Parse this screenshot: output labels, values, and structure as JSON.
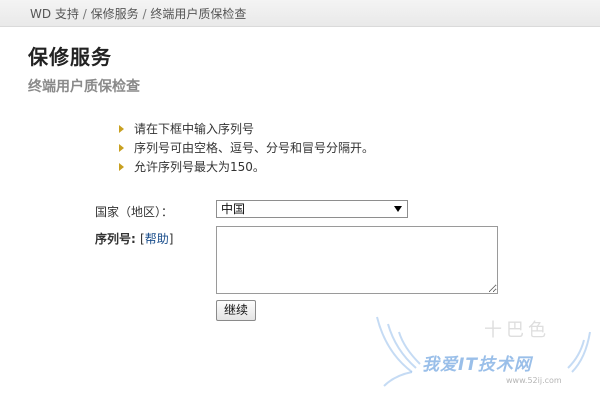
{
  "breadcrumb": {
    "items": [
      "WD 支持",
      "保修服务",
      "终端用户质保检查"
    ],
    "separator": "/"
  },
  "page": {
    "title": "保修服务",
    "subtitle": "终端用户质保检查"
  },
  "instructions": [
    "请在下框中输入序列号",
    "序列号可由空格、逗号、分号和冒号分隔开。",
    "允许序列号最大为150。"
  ],
  "form": {
    "country_label": "国家（地区）：",
    "country_value": "中国",
    "serial_label": "序列号:",
    "help_open": "[",
    "help_label": "帮助",
    "help_close": "]",
    "serial_value": "",
    "continue_label": "继续"
  },
  "watermark": {
    "text": "我爱IT技术网",
    "url": "www.52ij.com",
    "glyphs": "十巴色"
  },
  "colors": {
    "bullet": "#c8a020",
    "link": "#1a4e8c",
    "subtitle": "#8a8a8a",
    "watermark": "#78aae1"
  }
}
